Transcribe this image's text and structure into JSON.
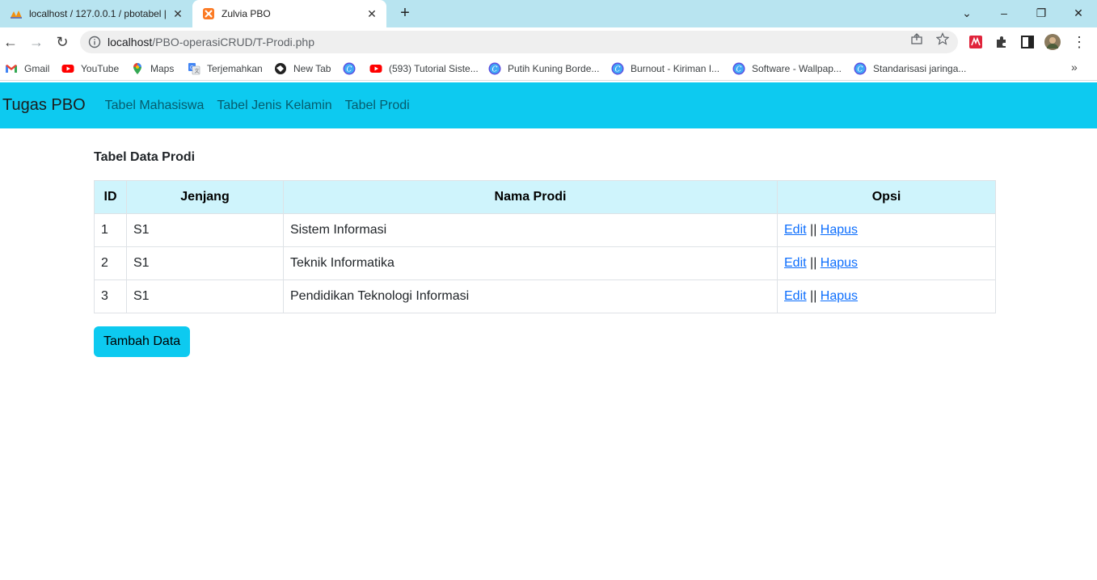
{
  "browser": {
    "tabs": [
      {
        "title": "localhost / 127.0.0.1 / pbotabel |",
        "active": false,
        "icon": "phpmyadmin-icon"
      },
      {
        "title": "Zulvia PBO",
        "active": true,
        "icon": "xampp-icon"
      }
    ],
    "url_host": "localhost",
    "url_path": "/PBO-operasiCRUD/T-Prodi.php",
    "bookmarks": [
      {
        "label": "Gmail",
        "icon": "gmail-icon"
      },
      {
        "label": "YouTube",
        "icon": "youtube-icon"
      },
      {
        "label": "Maps",
        "icon": "maps-icon"
      },
      {
        "label": "Terjemahkan",
        "icon": "translate-icon"
      },
      {
        "label": "New Tab",
        "icon": "newtab-icon"
      },
      {
        "label": "",
        "icon": "canva-icon"
      },
      {
        "label": "(593) Tutorial Siste...",
        "icon": "youtube-icon"
      },
      {
        "label": "Putih Kuning Borde...",
        "icon": "canva-icon"
      },
      {
        "label": "Burnout - Kiriman I...",
        "icon": "canva-icon"
      },
      {
        "label": "Software - Wallpap...",
        "icon": "canva-icon"
      },
      {
        "label": "Standarisasi jaringa...",
        "icon": "canva-icon"
      }
    ]
  },
  "navbar": {
    "brand": "Tugas PBO",
    "links": [
      "Tabel Mahasiswa",
      "Tabel Jenis Kelamin",
      "Tabel Prodi"
    ],
    "color": "#0dcaf0"
  },
  "main": {
    "heading": "Tabel Data Prodi",
    "columns": [
      "ID",
      "Jenjang",
      "Nama Prodi",
      "Opsi"
    ],
    "rows": [
      {
        "id": "1",
        "jenjang": "S1",
        "nama": "Sistem Informasi",
        "edit": "Edit",
        "sep": "||",
        "hapus": "Hapus"
      },
      {
        "id": "2",
        "jenjang": "S1",
        "nama": "Teknik Informatika",
        "edit": "Edit",
        "sep": "||",
        "hapus": "Hapus"
      },
      {
        "id": "3",
        "jenjang": "S1",
        "nama": "Pendidikan Teknologi Informasi",
        "edit": "Edit",
        "sep": "||",
        "hapus": "Hapus"
      }
    ],
    "add_button": "Tambah Data"
  }
}
